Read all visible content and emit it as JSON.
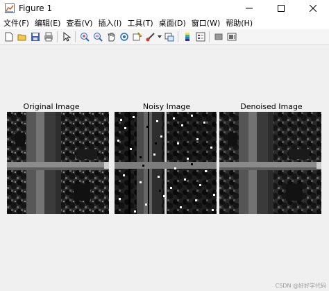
{
  "window": {
    "title": "Figure 1"
  },
  "menu": [
    "文件(F)",
    "编辑(E)",
    "查看(V)",
    "插入(I)",
    "工具(T)",
    "桌面(D)",
    "窗口(W)",
    "帮助(H)"
  ],
  "toolbar": [
    "new-figure-icon",
    "open-file-icon",
    "save-icon",
    "print-icon",
    "pointer-icon",
    "zoom-in-icon",
    "zoom-out-icon",
    "pan-icon",
    "rotate-3d-icon",
    "data-cursor-icon",
    "brush-icon",
    "brush-dropdown-icon",
    "link-plot-icon",
    "colorbar-icon",
    "legend-icon",
    "hide-plot-tools-icon",
    "show-plot-tools-icon"
  ],
  "axes": [
    {
      "title": "Original Image"
    },
    {
      "title": "Noisy Image"
    },
    {
      "title": "Denoised Image"
    }
  ],
  "watermark": "CSDN @好好学代码"
}
